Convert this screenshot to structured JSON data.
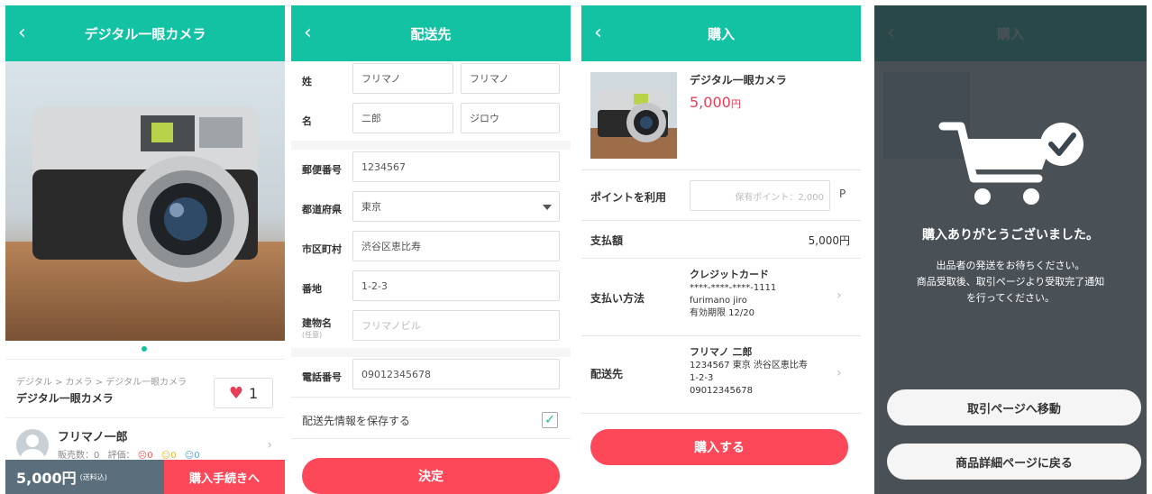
{
  "screen1": {
    "title": "デジタル一眼カメラ",
    "breadcrumb": "デジタル > カメラ > デジタル一眼カメラ",
    "product_name": "デジタル一眼カメラ",
    "like_count": "1",
    "seller_name": "フリマノ一郎",
    "sales_label": "販売数：0",
    "rating_label": "評価：",
    "rating_bad": "0",
    "rating_neutral": "0",
    "rating_good": "0",
    "price": "5,000円",
    "shipping_note": "(送料込)",
    "buy_button": "購入手続きへ"
  },
  "screen2": {
    "title": "配送先",
    "last_name_label": "姓",
    "last_name_value": "フリマノ",
    "last_name_kana": "フリマノ",
    "first_name_label": "名",
    "first_name_value": "二郎",
    "first_name_kana": "ジロウ",
    "postal_label": "郵便番号",
    "postal_value": "1234567",
    "prefecture_label": "都道府県",
    "prefecture_value": "東京",
    "city_label": "市区町村",
    "city_value": "渋谷区恵比寿",
    "address_label": "番地",
    "address_value": "1-2-3",
    "building_label": "建物名",
    "building_optional": "(任意)",
    "building_placeholder": "フリマノビル",
    "phone_label": "電話番号",
    "phone_value": "09012345678",
    "save_label": "配送先情報を保存する",
    "submit_button": "決定"
  },
  "screen3": {
    "title": "購入",
    "product_name": "デジタル一眼カメラ",
    "price_number": "5,000",
    "price_unit": "円",
    "points_label": "ポイントを利用",
    "points_placeholder": "保有ポイント：2,000",
    "points_unit": "P",
    "total_label": "支払額",
    "total_value": "5,000円",
    "payment_label": "支払い方法",
    "card_type": "クレジットカード",
    "card_number": "****-****-****-1111",
    "card_holder": "furimano jiro",
    "card_expiry": "有効期限 12/20",
    "shipping_label": "配送先",
    "ship_name": "フリマノ 二郎",
    "ship_address": "1234567 東京 渋谷区恵比寿",
    "ship_street": "1-2-3",
    "ship_phone": "09012345678",
    "buy_button": "購入する"
  },
  "screen4": {
    "title": "購入",
    "thanks": "購入ありがとうございました。",
    "message_line1": "出品者の発送をお待ちください。",
    "message_line2": "商品受取後、取引ページより受取完了通知",
    "message_line3": "を行ってください。",
    "btn_transaction": "取引ページへ移動",
    "btn_product": "商品詳細ページに戻る"
  },
  "colors": {
    "header_teal": "#13c1a3",
    "accent_red": "#fc4859",
    "price_red": "#e63e56",
    "bar_slate": "#5a6e7b"
  },
  "icons": [
    "back-arrow-icon",
    "heart-icon",
    "chevron-right-icon",
    "dropdown-caret-icon",
    "checkmark-icon",
    "cart-check-icon"
  ]
}
